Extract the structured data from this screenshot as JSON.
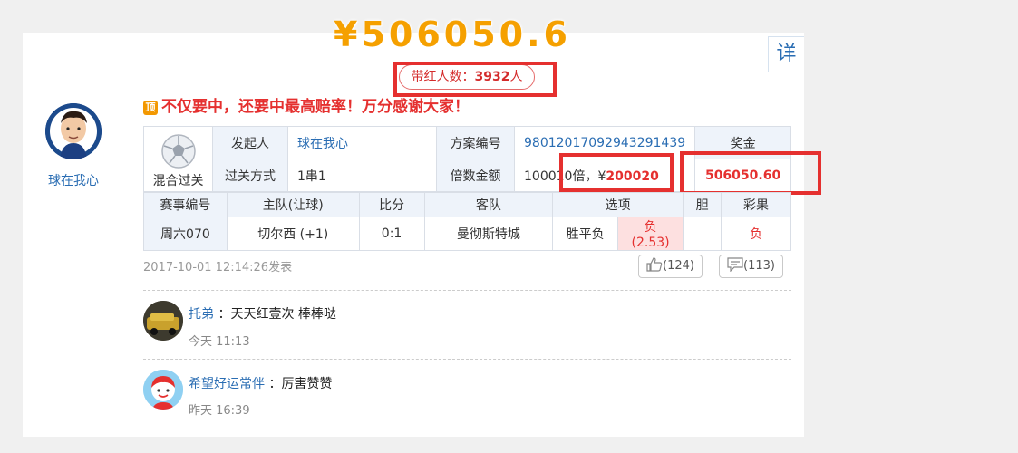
{
  "prize_banner": "¥506050.6",
  "detail_tab": "详",
  "winners_count": {
    "prefix": "带红人数：",
    "value": "3932",
    "suffix": "人"
  },
  "user": {
    "name": "球在我心"
  },
  "slogan": {
    "badge": "顶",
    "text": "不仅要中，还要中最高赔率！万分感谢大家！"
  },
  "plan": {
    "type_label": "混合过关",
    "initiator_label": "发起人",
    "initiator_value": "球在我心",
    "plan_no_label": "方案编号",
    "plan_no_value": "98012017092943291439",
    "prize_label": "奖金",
    "pass_method_label": "过关方式",
    "pass_method_value": "1串1",
    "multiple_label": "倍数金额",
    "multiple_value_prefix": "100010倍，¥",
    "multiple_amount": "200020",
    "prize_value": "506050.60"
  },
  "match_table": {
    "headers": [
      "赛事编号",
      "主队(让球)",
      "比分",
      "客队",
      "选项",
      "胆",
      "彩果"
    ],
    "row": {
      "match_no": "周六070",
      "home": "切尔西 (+1)",
      "score": "0:1",
      "away": "曼彻斯特城",
      "option1": "胜平负",
      "option2": "负(2.53)",
      "banker": "",
      "result": "负"
    }
  },
  "post": {
    "date": "2017-10-01 12:14:26发表",
    "likes": "(124)",
    "comments": "(113)"
  },
  "comments": [
    {
      "name": "托弟",
      "sep": "：",
      "text": "天天红壹次 棒棒哒",
      "time": "今天 11:13"
    },
    {
      "name": "希望好运常伴",
      "sep": "：",
      "text": "厉害赞赞",
      "time": "昨天 16:39"
    }
  ],
  "colors": {
    "accent_red": "#e5302f",
    "link_blue": "#2a6db3",
    "prize_gold": "#f5a000"
  }
}
